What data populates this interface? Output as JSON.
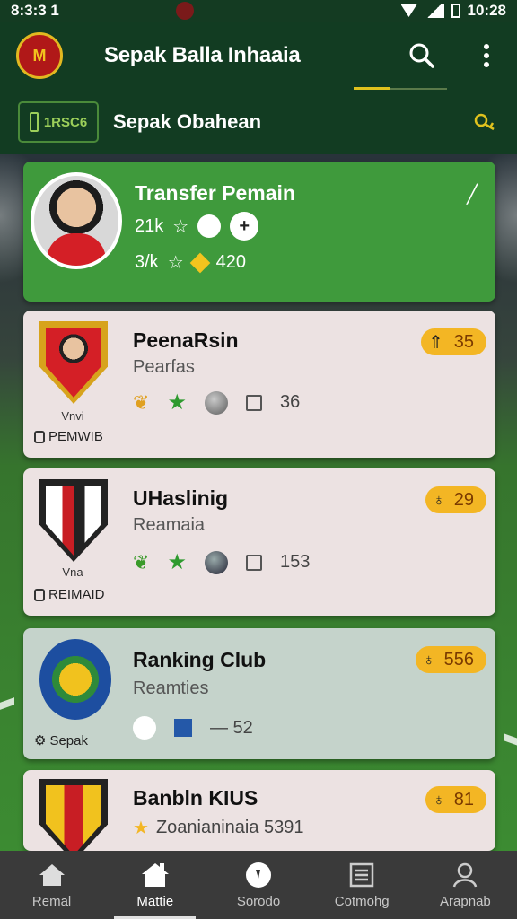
{
  "status_bar": {
    "time": "8:3:3 1",
    "right_time": "10:28"
  },
  "app_bar": {
    "title": "Sepak Balla Inhaaia"
  },
  "sub_bar": {
    "badge_text": "1RSC6",
    "title": "Sepak Obahean"
  },
  "featured_card": {
    "title": "Transfer Pemain",
    "row1_value": "21k",
    "row2_value": "3/k",
    "row2_extra": "420"
  },
  "cards": [
    {
      "name": "PeenaRsin",
      "subtitle": "Pearfas",
      "crest_caption": "Vnvi",
      "side_label": "PEMWIB",
      "stat_value": "36",
      "pill_value": "35"
    },
    {
      "name": "UHaslinig",
      "subtitle": "Reamaia",
      "crest_caption": "Vna",
      "side_label": "REIMAID",
      "stat_value": "153",
      "pill_value": "29"
    },
    {
      "name": "Ranking Club",
      "subtitle": "Reamties",
      "side_label": "Sepak",
      "stat_value": "— 52",
      "pill_value": "556"
    },
    {
      "name": "Banbln KIUS",
      "subtitle": "Zoanianinaia 5391",
      "pill_value": "81"
    }
  ],
  "bottom_nav": [
    {
      "label": "Remal",
      "icon": "home-icon",
      "active": false
    },
    {
      "label": "Mattie",
      "icon": "store-icon",
      "active": true
    },
    {
      "label": "Sorodo",
      "icon": "ball-icon",
      "active": false
    },
    {
      "label": "Cotmohg",
      "icon": "list-icon",
      "active": false
    },
    {
      "label": "Arapnab",
      "icon": "profile-icon",
      "active": false
    }
  ],
  "colors": {
    "app_bar": "#123c22",
    "featured": "#3f9a3c",
    "pill": "#f3b624",
    "nav": "#3a3a3a"
  }
}
